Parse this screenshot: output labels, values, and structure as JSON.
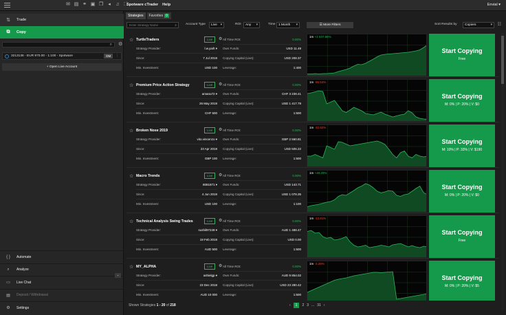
{
  "topbar": {
    "menu": [
      "Spotware cTrader",
      "Help"
    ],
    "user": "Envial ▾"
  },
  "left": {
    "nav": [
      {
        "label": "Trade",
        "icon": "trade-icon"
      },
      {
        "label": "Copy",
        "icon": "copy-icon"
      }
    ],
    "account": {
      "text": "3213136 - EUR 970.00 - 1:100 - Spotware",
      "badge": "DM"
    },
    "open_live": "+ Open Live Account",
    "bottom": [
      {
        "label": "Automate",
        "icon": "automate-icon"
      },
      {
        "label": "Analyze",
        "icon": "analyze-icon"
      },
      {
        "label": "Live Chat",
        "icon": "chat-icon"
      },
      {
        "label": "Deposit / Withdrawal",
        "icon": "wallet-icon"
      },
      {
        "label": "Settings",
        "icon": "settings-icon"
      }
    ]
  },
  "tabs": {
    "strategies": "Strategies",
    "favorites": "Favorites",
    "favorites_count": "0"
  },
  "filter": {
    "search_placeholder": "Enter Strategy Name",
    "account_type_label": "Account Type",
    "account_type": "Live",
    "roi_label": "ROI",
    "roi": "Any",
    "time_label": "Time",
    "time": "1 Month",
    "more_filters": "More Filters",
    "sort_label": "Sort Results by",
    "sort_value": "Copiers"
  },
  "labels": {
    "provider": "Strategy Provider:",
    "since": "Since:",
    "min_inv": "Min. Investment:",
    "roi": "All Time ROI:",
    "own_funds": "Own Funds:",
    "copy_capital": "Copying Capital (Live):",
    "leverage": "Leverage:",
    "live": "Live",
    "start_copying": "Start Copying"
  },
  "strategies": [
    {
      "name": "TurtleTraders",
      "provider": "l.w.yarlt ▾",
      "since": "7 Jul 2019",
      "min": "USD 100",
      "roi": "0.00%",
      "own": "USD 11.49",
      "capital": "USD 208.37",
      "leverage": "1:400",
      "chart_label": "1m",
      "chart_change": "+2 037.86%",
      "change_dir": "up",
      "fee": "Free",
      "series": [
        0.05,
        0.05,
        0.06,
        0.05,
        0.06,
        0.06,
        0.07,
        0.08,
        0.12,
        0.15,
        0.18,
        0.22,
        0.28,
        0.33,
        0.32,
        0.36,
        0.42,
        0.48,
        0.55,
        0.6,
        0.62,
        0.63,
        0.64,
        0.65,
        0.66,
        0.67,
        0.68,
        0.7,
        0.72,
        0.75,
        0.82,
        0.9
      ]
    },
    {
      "name": "Premium Price Action Strategy",
      "provider": "amanu72 ▾",
      "since": "26 May 2019",
      "min": "CHF 500",
      "roi": "0.00%",
      "own": "CHF 3 238.41",
      "capital": "USD 1 417.79",
      "leverage": "1:500",
      "chart_label": "1m",
      "chart_change": "-96.54%",
      "change_dir": "dn",
      "fee": "M: 0% | P: 20% | V: $0",
      "series": [
        0.8,
        0.82,
        0.85,
        0.88,
        0.86,
        0.5,
        0.55,
        0.6,
        0.45,
        0.3,
        0.25,
        0.32,
        0.4,
        0.35,
        0.3,
        0.22,
        0.2,
        0.18,
        0.22,
        0.26,
        0.2,
        0.16,
        0.12,
        0.15,
        0.18,
        0.2,
        0.3,
        0.24,
        0.12,
        0.08,
        0.06,
        0.05
      ]
    },
    {
      "name": "Broken Nose 2019",
      "provider": "vito.vincenzo ▾",
      "since": "23 Apr 2019",
      "min": "GBP 100",
      "roi": "0.00%",
      "own": "GBP 2 560.81",
      "capital": "USD 506.22",
      "leverage": "1:500",
      "chart_label": "1m",
      "chart_change": "-32.82%",
      "change_dir": "dn",
      "fee": "M: 10% | P: 33% | V: $190",
      "series": [
        0.3,
        0.3,
        0.35,
        0.3,
        0.25,
        0.6,
        0.55,
        0.5,
        0.72,
        0.7,
        0.65,
        0.6,
        0.62,
        0.64,
        0.66,
        0.68,
        0.7,
        0.72,
        0.74,
        0.7,
        0.64,
        0.5,
        0.35,
        0.25,
        0.4,
        0.45,
        0.3,
        0.25,
        0.35,
        0.3,
        0.28,
        0.3
      ]
    },
    {
      "name": "Macro Trends",
      "provider": "8081871 ▾",
      "since": "4 Jun 2019",
      "min": "USD 100",
      "roi": "0.00%",
      "own": "USD 143.71",
      "capital": "USD 1 078.35",
      "leverage": "1:100",
      "chart_label": "1m",
      "chart_change": "+48.20%",
      "change_dir": "up",
      "fee": "M: 0% | P: 20% | V: $0",
      "series": [
        0.15,
        0.18,
        0.2,
        0.22,
        0.25,
        0.28,
        0.3,
        0.35,
        0.45,
        0.5,
        0.48,
        0.55,
        0.62,
        0.7,
        0.75,
        0.82,
        0.78,
        0.7,
        0.6,
        0.55,
        0.58,
        0.62,
        0.6,
        0.48,
        0.45,
        0.5,
        0.52,
        0.6,
        0.68,
        0.75,
        0.55,
        0.5
      ]
    },
    {
      "name": "Technical Analysis Swing Trades",
      "provider": "sushil97249 ▾",
      "since": "19 Feb 2019",
      "min": "AUD 500",
      "roi": "0.00%",
      "own": "AUD 1 488.47",
      "capital": "USD 0.00",
      "leverage": "1:500",
      "chart_label": "1m",
      "chart_change": "-13.81%",
      "change_dir": "dn",
      "fee": "Free",
      "series": [
        0.75,
        0.78,
        0.7,
        0.72,
        0.6,
        0.55,
        0.58,
        0.5,
        0.52,
        0.55,
        0.6,
        0.45,
        0.35,
        0.3,
        0.32,
        0.35,
        0.28,
        0.3,
        0.32,
        0.35,
        0.33,
        0.3,
        0.36,
        0.38,
        0.4,
        0.35,
        0.3,
        0.34,
        0.3,
        0.28,
        0.32,
        0.3
      ]
    },
    {
      "name": "MY_ALPHA",
      "provider": "ashielgp ▾",
      "since": "23 Dec 2018",
      "min": "AUD 10 000",
      "roi": "0.00%",
      "own": "AUD 9 854.02",
      "capital": "USD 23 280.42",
      "leverage": "1:500",
      "chart_label": "1m",
      "chart_change": "-3.28%",
      "change_dir": "dn",
      "fee": "M: 0% | P: 20% | V: $5",
      "series": [
        0.3,
        0.35,
        0.4,
        0.45,
        0.5,
        0.55,
        0.6,
        0.65,
        0.68,
        0.7,
        0.72,
        0.75,
        0.78,
        0.8,
        0.82,
        0.84,
        0.86,
        0.88,
        0.88,
        0.87,
        0.88,
        0.89,
        0.9,
        0.1,
        0.12,
        0.14,
        0.16,
        0.18,
        0.2,
        0.22,
        0.24,
        0.26
      ]
    }
  ],
  "footer": {
    "shown_label": "Shown Strategies",
    "shown_range": "1 - 20",
    "of": "of",
    "total": "218",
    "pages": [
      "‹",
      "1",
      "2",
      "3",
      "...",
      "31",
      "›"
    ]
  },
  "colors": {
    "accent": "#15994a",
    "up": "#2fb559",
    "down": "#e8452c"
  }
}
